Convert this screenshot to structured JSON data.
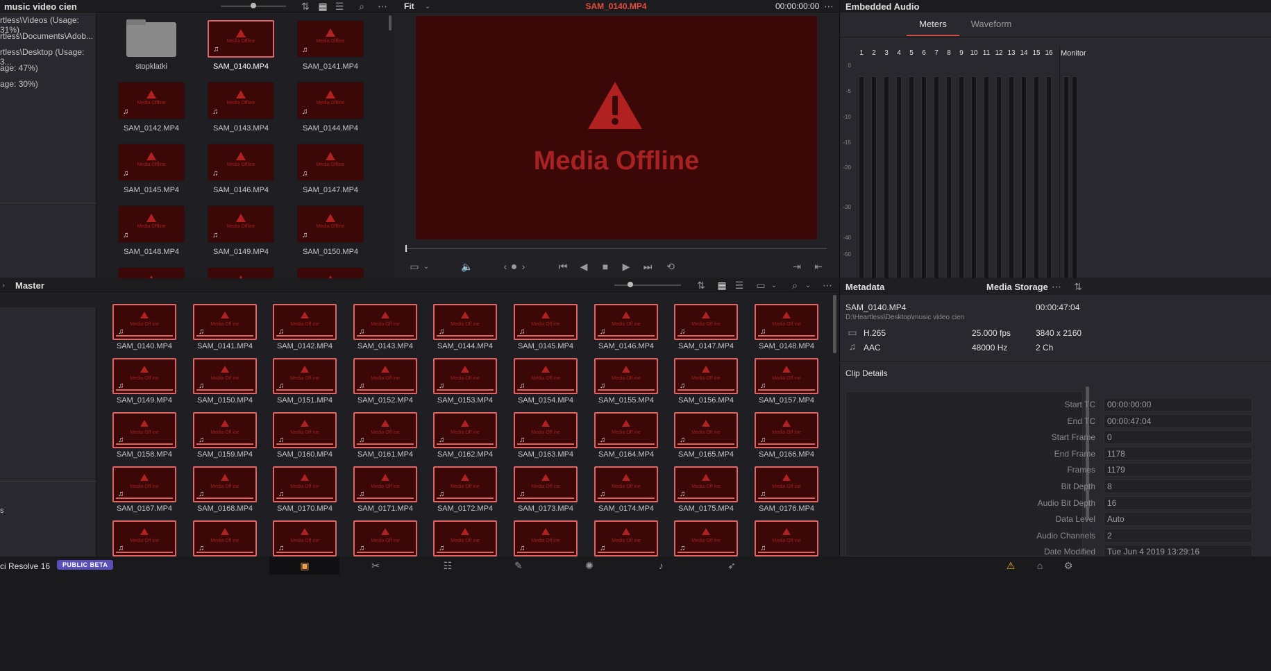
{
  "app": {
    "name": "ci Resolve 16",
    "badge": "PUBLIC BETA"
  },
  "media_pool_top": {
    "title": "music video cien",
    "tree": [
      "rtless\\Videos (Usage: 31%)",
      "rtless\\Documents\\Adob...",
      "rtless\\Desktop (Usage: 3...",
      "age: 47%)",
      "age: 30%)"
    ],
    "folder": "stopklatki",
    "clips": [
      "SAM_0140.MP4",
      "SAM_0141.MP4",
      "SAM_0142.MP4",
      "SAM_0143.MP4",
      "SAM_0144.MP4",
      "SAM_0145.MP4",
      "SAM_0146.MP4",
      "SAM_0147.MP4",
      "SAM_0148.MP4",
      "SAM_0149.MP4",
      "SAM_0150.MP4"
    ]
  },
  "viewer": {
    "zoom": "Fit",
    "clip_name": "SAM_0140.MP4",
    "timecode": "00:00:00:00",
    "offline_text": "Media Offline"
  },
  "audio": {
    "title": "Embedded Audio",
    "tabs": [
      "Meters",
      "Waveform"
    ],
    "active_tab": "Meters",
    "channels": [
      "1",
      "2",
      "3",
      "4",
      "5",
      "6",
      "7",
      "8",
      "9",
      "10",
      "11",
      "12",
      "13",
      "14",
      "15",
      "16"
    ],
    "monitor_label": "Monitor",
    "scale": [
      "0",
      "-5",
      "-10",
      "-15",
      "-20",
      "-30",
      "-40",
      "-50"
    ]
  },
  "bin": {
    "title": "Master",
    "clips_thumb_text": "Media Off ine",
    "clips": [
      "SAM_0140.MP4",
      "SAM_0141.MP4",
      "SAM_0142.MP4",
      "SAM_0143.MP4",
      "SAM_0144.MP4",
      "SAM_0145.MP4",
      "SAM_0146.MP4",
      "SAM_0147.MP4",
      "SAM_0148.MP4",
      "SAM_0149.MP4",
      "SAM_0150.MP4",
      "SAM_0151.MP4",
      "SAM_0152.MP4",
      "SAM_0153.MP4",
      "SAM_0154.MP4",
      "SAM_0155.MP4",
      "SAM_0156.MP4",
      "SAM_0157.MP4",
      "SAM_0158.MP4",
      "SAM_0159.MP4",
      "SAM_0160.MP4",
      "SAM_0161.MP4",
      "SAM_0162.MP4",
      "SAM_0163.MP4",
      "SAM_0164.MP4",
      "SAM_0165.MP4",
      "SAM_0166.MP4",
      "SAM_0167.MP4",
      "SAM_0168.MP4",
      "SAM_0170.MP4",
      "SAM_0171.MP4",
      "SAM_0172.MP4",
      "SAM_0173.MP4",
      "SAM_0174.MP4",
      "SAM_0175.MP4",
      "SAM_0176.MP4",
      "",
      "",
      "",
      "",
      "",
      "",
      "",
      "",
      ""
    ],
    "side_label": "s"
  },
  "metadata": {
    "tab_metadata": "Metadata",
    "tab_storage": "Media Storage",
    "clip": "SAM_0140.MP4",
    "duration": "00:00:47:04",
    "path": "D:\\Heartless\\Desktop\\music video cien",
    "video_codec": "H.265",
    "fps": "25.000 fps",
    "resolution": "3840 x 2160",
    "audio_codec": "AAC",
    "sample_rate": "48000 Hz",
    "channels": "2 Ch",
    "clip_details_title": "Clip Details",
    "details": [
      {
        "k": "Start TC",
        "v": "00:00:00:00"
      },
      {
        "k": "End TC",
        "v": "00:00:47:04"
      },
      {
        "k": "Start Frame",
        "v": "0"
      },
      {
        "k": "End Frame",
        "v": "1178"
      },
      {
        "k": "Frames",
        "v": "1179"
      },
      {
        "k": "Bit Depth",
        "v": "8"
      },
      {
        "k": "Audio Bit Depth",
        "v": "16"
      },
      {
        "k": "Data Level",
        "v": "Auto"
      },
      {
        "k": "Audio Channels",
        "v": "2"
      },
      {
        "k": "Date Modified",
        "v": "Tue Jun 4 2019 13:29:16"
      }
    ]
  },
  "pages": [
    "media-page-icon",
    "cut-page-icon",
    "edit-page-icon",
    "fusion-page-icon",
    "color-page-icon",
    "fairlight-page-icon",
    "deliver-page-icon"
  ],
  "colors": {
    "offline": "#3b0707",
    "selected": "#e06666",
    "accent": "#e64b3c"
  }
}
